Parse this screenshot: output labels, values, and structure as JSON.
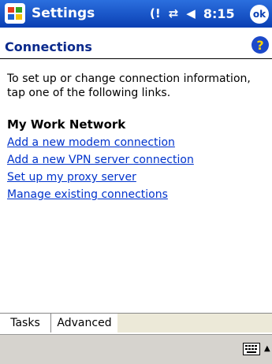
{
  "titlebar": {
    "app_title": "Settings",
    "time": "8:15",
    "ok_label": "ok",
    "icons": [
      "windows-start-icon",
      "notification-icon",
      "connectivity-icon",
      "speaker-icon"
    ]
  },
  "header": {
    "section_title": "Connections",
    "help_label": "?"
  },
  "content": {
    "intro": "To set up or change connection information, tap one of the following links.",
    "group_title": "My Work Network",
    "links": [
      "Add a new modem connection",
      "Add a new VPN server connection",
      "Set up my proxy server",
      "Manage existing connections"
    ]
  },
  "tabs": [
    "Tasks",
    "Advanced"
  ],
  "menubar": {
    "icons": [
      "keyboard-icon",
      "sip-arrow-icon"
    ]
  },
  "colors": {
    "titlebar": "#0a3fb3",
    "section_title": "#0b2a8c",
    "link": "#0033cc",
    "menubar": "#d6d3ce"
  }
}
